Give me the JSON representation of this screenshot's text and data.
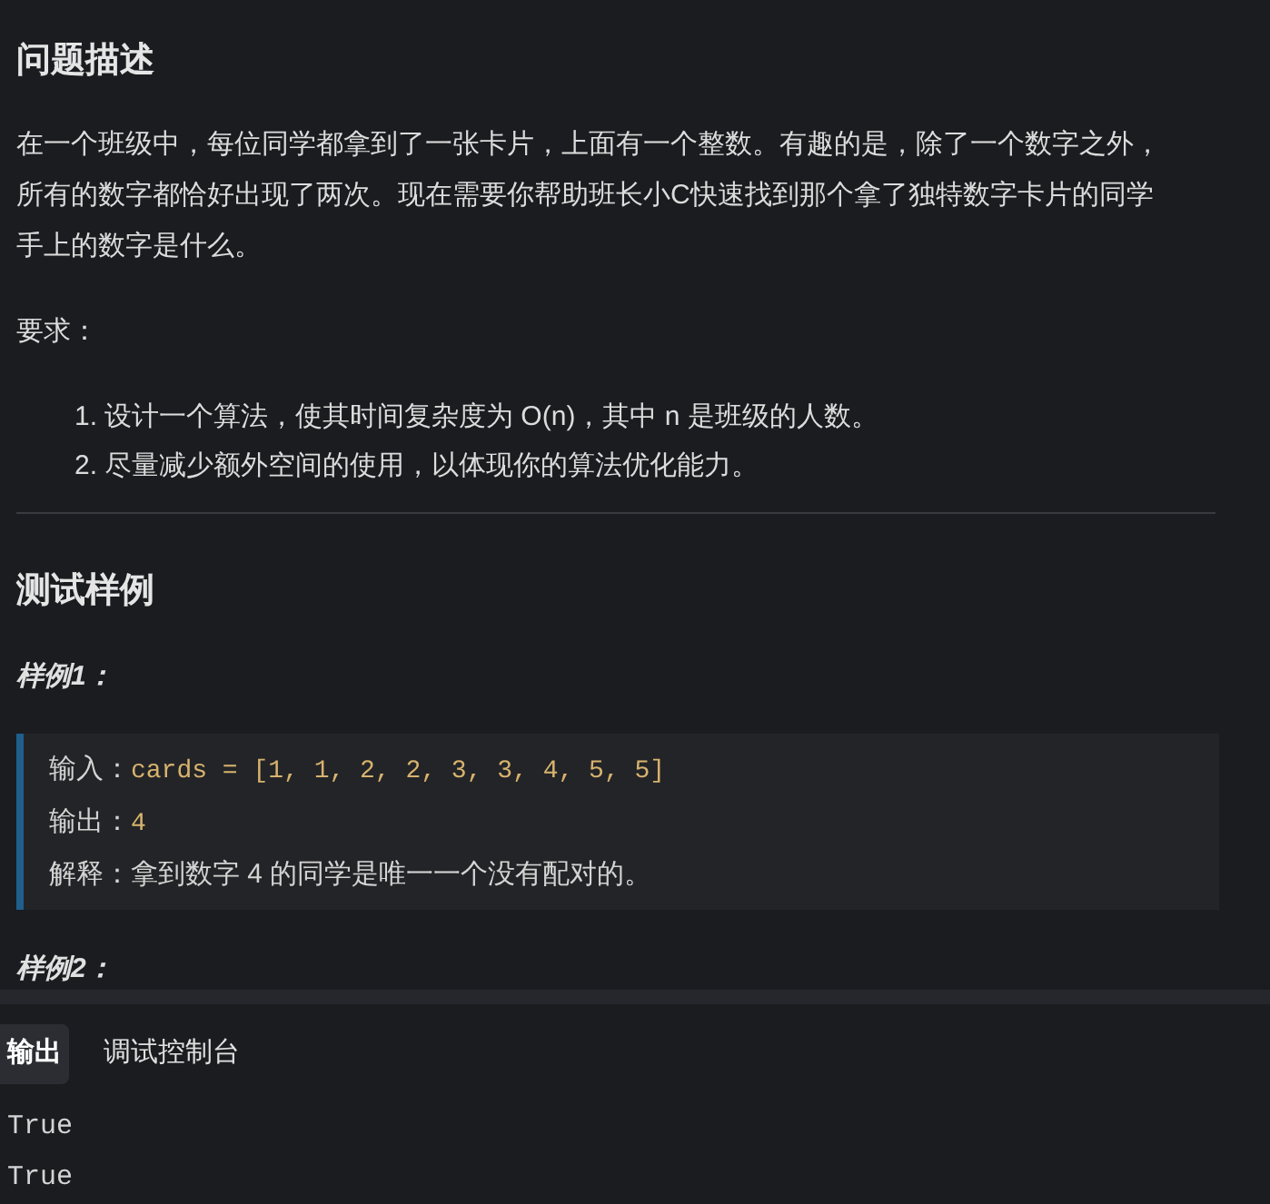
{
  "problem": {
    "heading": "问题描述",
    "paragraph": "在一个班级中，每位同学都拿到了一张卡片，上面有一个整数。有趣的是，除了一个数字之外，所有的数字都恰好出现了两次。现在需要你帮助班长小C快速找到那个拿了独特数字卡片的同学手上的数字是什么。",
    "requirements_label": "要求：",
    "requirements": [
      {
        "marker": "1.",
        "text": "设计一个算法，使其时间复杂度为 O(n)，其中 n 是班级的人数。"
      },
      {
        "marker": "2.",
        "text": "尽量减少额外空间的使用，以体现你的算法优化能力。"
      }
    ]
  },
  "tests": {
    "heading": "测试样例",
    "samples": [
      {
        "title": "样例1：",
        "lines": [
          {
            "label": "输入：",
            "code": "cards = [1, 1, 2, 2, 3, 3, 4, 5, 5]"
          },
          {
            "label": "输出：",
            "code": "4"
          },
          {
            "label": "解释：",
            "text": "拿到数字 4 的同学是唯一一个没有配对的。"
          }
        ]
      },
      {
        "title": "样例2："
      }
    ]
  },
  "output_panel": {
    "tabs": [
      {
        "label": "输出",
        "selected": true
      },
      {
        "label": "调试控制台",
        "selected": false
      }
    ],
    "lines": [
      "True",
      "True"
    ]
  }
}
